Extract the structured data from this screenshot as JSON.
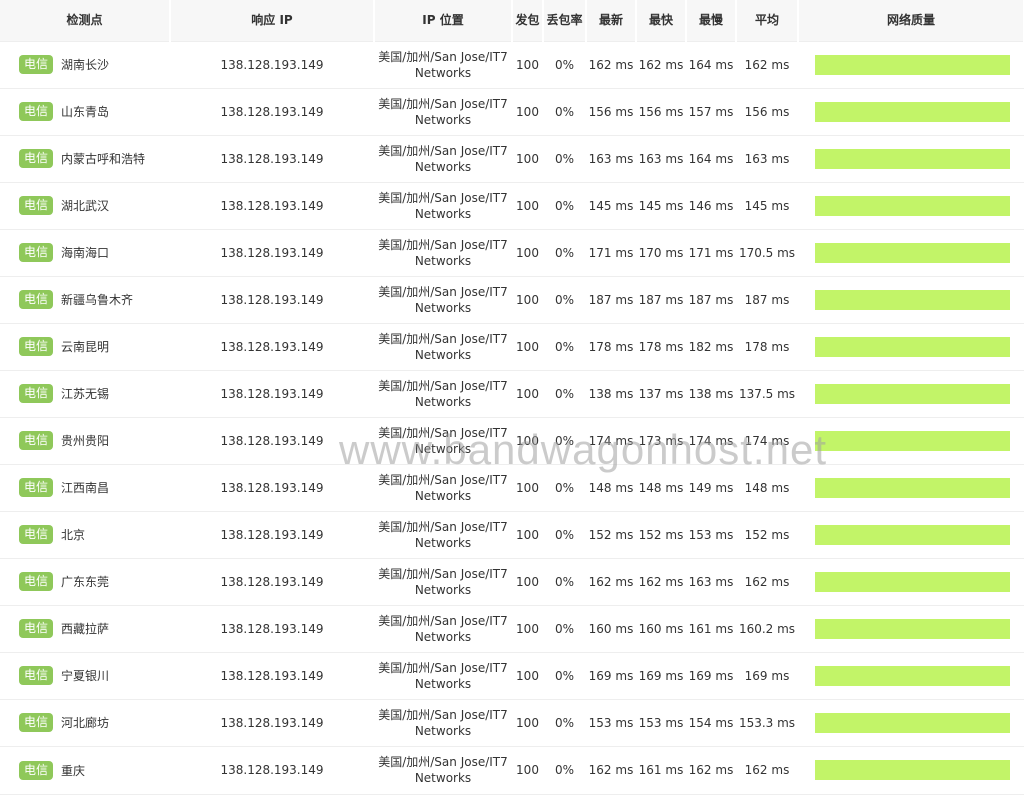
{
  "headers": {
    "location": "检测点",
    "ip": "响应 IP",
    "geo": "IP 位置",
    "sent": "发包",
    "loss": "丢包率",
    "latest": "最新",
    "fastest": "最快",
    "slowest": "最慢",
    "average": "平均",
    "quality": "网络质量"
  },
  "colors": {
    "isp_badge": "#8fc85a",
    "quality_bar": "#c2f468"
  },
  "rows": [
    {
      "isp": "电信",
      "city": "湖南长沙",
      "ip": "138.128.193.149",
      "geo1": "美国/加州/San Jose/IT7",
      "geo2": "Networks",
      "sent": "100",
      "loss": "0%",
      "latest": "162 ms",
      "fastest": "162 ms",
      "slowest": "164 ms",
      "avg": "162 ms"
    },
    {
      "isp": "电信",
      "city": "山东青岛",
      "ip": "138.128.193.149",
      "geo1": "美国/加州/San Jose/IT7",
      "geo2": "Networks",
      "sent": "100",
      "loss": "0%",
      "latest": "156 ms",
      "fastest": "156 ms",
      "slowest": "157 ms",
      "avg": "156 ms"
    },
    {
      "isp": "电信",
      "city": "内蒙古呼和浩特",
      "ip": "138.128.193.149",
      "geo1": "美国/加州/San Jose/IT7",
      "geo2": "Networks",
      "sent": "100",
      "loss": "0%",
      "latest": "163 ms",
      "fastest": "163 ms",
      "slowest": "164 ms",
      "avg": "163 ms"
    },
    {
      "isp": "电信",
      "city": "湖北武汉",
      "ip": "138.128.193.149",
      "geo1": "美国/加州/San Jose/IT7",
      "geo2": "Networks",
      "sent": "100",
      "loss": "0%",
      "latest": "145 ms",
      "fastest": "145 ms",
      "slowest": "146 ms",
      "avg": "145 ms"
    },
    {
      "isp": "电信",
      "city": "海南海口",
      "ip": "138.128.193.149",
      "geo1": "美国/加州/San Jose/IT7",
      "geo2": "Networks",
      "sent": "100",
      "loss": "0%",
      "latest": "171 ms",
      "fastest": "170 ms",
      "slowest": "171 ms",
      "avg": "170.5 ms"
    },
    {
      "isp": "电信",
      "city": "新疆乌鲁木齐",
      "ip": "138.128.193.149",
      "geo1": "美国/加州/San Jose/IT7",
      "geo2": "Networks",
      "sent": "100",
      "loss": "0%",
      "latest": "187 ms",
      "fastest": "187 ms",
      "slowest": "187 ms",
      "avg": "187 ms"
    },
    {
      "isp": "电信",
      "city": "云南昆明",
      "ip": "138.128.193.149",
      "geo1": "美国/加州/San Jose/IT7",
      "geo2": "Networks",
      "sent": "100",
      "loss": "0%",
      "latest": "178 ms",
      "fastest": "178 ms",
      "slowest": "182 ms",
      "avg": "178 ms"
    },
    {
      "isp": "电信",
      "city": "江苏无锡",
      "ip": "138.128.193.149",
      "geo1": "美国/加州/San Jose/IT7",
      "geo2": "Networks",
      "sent": "100",
      "loss": "0%",
      "latest": "138 ms",
      "fastest": "137 ms",
      "slowest": "138 ms",
      "avg": "137.5 ms"
    },
    {
      "isp": "电信",
      "city": "贵州贵阳",
      "ip": "138.128.193.149",
      "geo1": "美国/加州/San Jose/IT7",
      "geo2": "Networks",
      "sent": "100",
      "loss": "0%",
      "latest": "174 ms",
      "fastest": "173 ms",
      "slowest": "174 ms",
      "avg": "174 ms"
    },
    {
      "isp": "电信",
      "city": "江西南昌",
      "ip": "138.128.193.149",
      "geo1": "美国/加州/San Jose/IT7",
      "geo2": "Networks",
      "sent": "100",
      "loss": "0%",
      "latest": "148 ms",
      "fastest": "148 ms",
      "slowest": "149 ms",
      "avg": "148 ms"
    },
    {
      "isp": "电信",
      "city": "北京",
      "ip": "138.128.193.149",
      "geo1": "美国/加州/San Jose/IT7",
      "geo2": "Networks",
      "sent": "100",
      "loss": "0%",
      "latest": "152 ms",
      "fastest": "152 ms",
      "slowest": "153 ms",
      "avg": "152 ms"
    },
    {
      "isp": "电信",
      "city": "广东东莞",
      "ip": "138.128.193.149",
      "geo1": "美国/加州/San Jose/IT7",
      "geo2": "Networks",
      "sent": "100",
      "loss": "0%",
      "latest": "162 ms",
      "fastest": "162 ms",
      "slowest": "163 ms",
      "avg": "162 ms"
    },
    {
      "isp": "电信",
      "city": "西藏拉萨",
      "ip": "138.128.193.149",
      "geo1": "美国/加州/San Jose/IT7",
      "geo2": "Networks",
      "sent": "100",
      "loss": "0%",
      "latest": "160 ms",
      "fastest": "160 ms",
      "slowest": "161 ms",
      "avg": "160.2 ms"
    },
    {
      "isp": "电信",
      "city": "宁夏银川",
      "ip": "138.128.193.149",
      "geo1": "美国/加州/San Jose/IT7",
      "geo2": "Networks",
      "sent": "100",
      "loss": "0%",
      "latest": "169 ms",
      "fastest": "169 ms",
      "slowest": "169 ms",
      "avg": "169 ms"
    },
    {
      "isp": "电信",
      "city": "河北廊坊",
      "ip": "138.128.193.149",
      "geo1": "美国/加州/San Jose/IT7",
      "geo2": "Networks",
      "sent": "100",
      "loss": "0%",
      "latest": "153 ms",
      "fastest": "153 ms",
      "slowest": "154 ms",
      "avg": "153.3 ms"
    },
    {
      "isp": "电信",
      "city": "重庆",
      "ip": "138.128.193.149",
      "geo1": "美国/加州/San Jose/IT7",
      "geo2": "Networks",
      "sent": "100",
      "loss": "0%",
      "latest": "162 ms",
      "fastest": "161 ms",
      "slowest": "162 ms",
      "avg": "162 ms"
    }
  ],
  "watermark": "www.bandwagonhost.net"
}
